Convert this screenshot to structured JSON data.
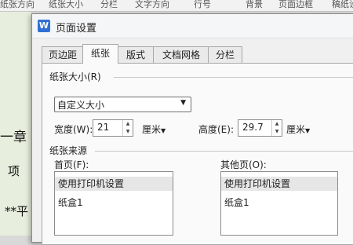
{
  "background": {
    "toolbar_items": [
      "纸张方向",
      "纸张大小",
      "分栏",
      "文字方向",
      "行号",
      "背景",
      "页面边框",
      "稿纸设置"
    ],
    "doc_text": [
      "一章",
      "项",
      "**平"
    ]
  },
  "dialog": {
    "icon_letter": "W",
    "title": "页面设置",
    "tabs": [
      {
        "label": "页边距",
        "active": false
      },
      {
        "label": "纸张",
        "active": true
      },
      {
        "label": "版式",
        "active": false
      },
      {
        "label": "文档网格",
        "active": false
      },
      {
        "label": "分栏",
        "active": false
      }
    ],
    "paper_size": {
      "group_label": "纸张大小(R)",
      "selected": "自定义大小",
      "width_label": "宽度(W):",
      "width_value": "21",
      "width_unit": "厘米",
      "height_label": "高度(E):",
      "height_value": "29.7",
      "height_unit": "厘米"
    },
    "paper_source": {
      "group_label": "纸张来源",
      "first_page_label": "首页(F):",
      "first_page_items": [
        "使用打印机设置",
        "纸盒1"
      ],
      "other_pages_label": "其他页(O):",
      "other_pages_items": [
        "使用打印机设置",
        "纸盒1"
      ]
    }
  }
}
